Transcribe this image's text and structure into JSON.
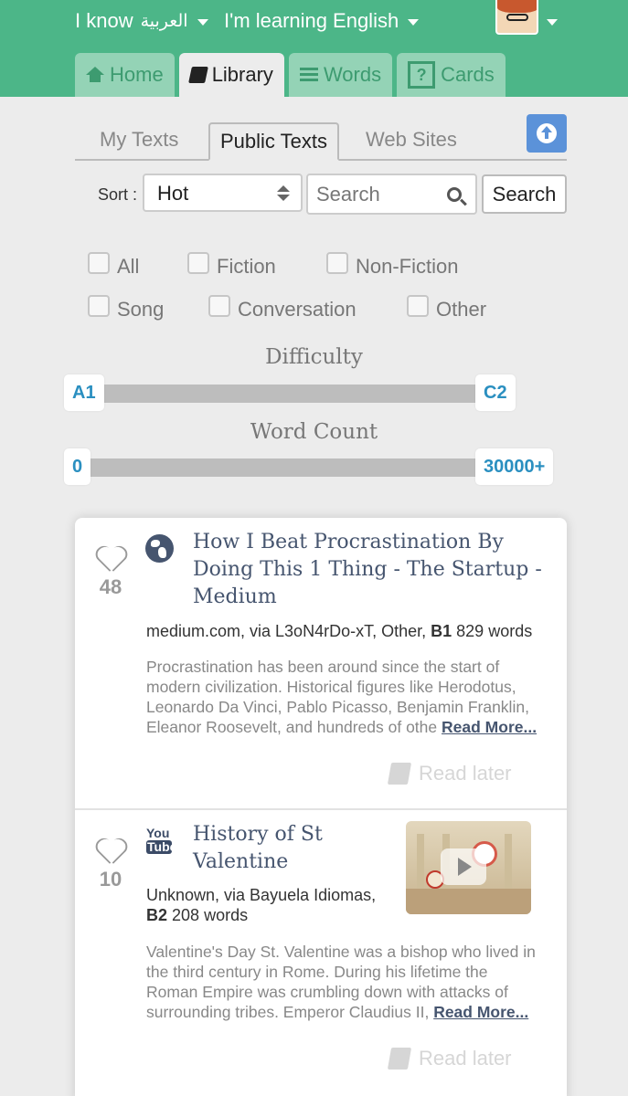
{
  "header": {
    "i_know_label": "I know",
    "i_know_value": "العربية",
    "learning_prefix": "I'm learning",
    "learning_value": "English"
  },
  "nav_tabs": [
    {
      "label": "Home",
      "icon": "home-icon"
    },
    {
      "label": "Library",
      "icon": "book-icon",
      "active": true
    },
    {
      "label": "Words",
      "icon": "list-icon"
    },
    {
      "label": "Cards",
      "icon": "question-card-icon"
    }
  ],
  "sub_tabs": [
    {
      "label": "My Texts"
    },
    {
      "label": "Public Texts",
      "active": true
    },
    {
      "label": "Web Sites"
    }
  ],
  "sort": {
    "label": "Sort :",
    "value": "Hot"
  },
  "search": {
    "placeholder": "Search",
    "button_label": "Search"
  },
  "filters": [
    {
      "label": "All",
      "checked": false
    },
    {
      "label": "Fiction",
      "checked": false
    },
    {
      "label": "Non-Fiction",
      "checked": false
    },
    {
      "label": "Song",
      "checked": false
    },
    {
      "label": "Conversation",
      "checked": false
    },
    {
      "label": "Other",
      "checked": false
    }
  ],
  "difficulty": {
    "title": "Difficulty",
    "min": "A1",
    "max": "C2"
  },
  "word_count": {
    "title": "Word Count",
    "min": "0",
    "max": "30000+"
  },
  "cards": [
    {
      "likes": "48",
      "icon": "globe-icon",
      "title_lines": [
        "How I Beat Procrastination By",
        "Doing This 1 Thing - The Startup -",
        "Medium"
      ],
      "meta_prefix": "medium.com, via L3oN4rDo-xT, Other,",
      "level": "B1",
      "word_count": "829 words",
      "description": "Procrastination has been around since the start of modern civilization. Historical figures like Herodotus, Leonardo Da Vinci, Pablo Picasso, Benjamin Franklin, Eleanor Roosevelt, and hundreds of othe",
      "read_more": "Read More...",
      "read_later": "Read later"
    },
    {
      "likes": "10",
      "icon": "youtube-icon",
      "icon_text_top": "You",
      "icon_text_bottom": "Tube",
      "title_lines": [
        "History of St",
        "Valentine"
      ],
      "meta_prefix": "Unknown, via Bayuela Idiomas,",
      "level": "B2",
      "word_count": "208 words",
      "description": "Valentine's Day St. Valentine was a bishop who lived in the third century in Rome. During his lifetime the Roman Empire was crumbling down with attacks of surrounding tribes. Emperor Claudius II,",
      "read_more": "Read More...",
      "read_later": "Read later"
    }
  ],
  "colors": {
    "header_green": "#4cb688",
    "tab_inactive": "#94d3b6",
    "tab_text": "#3d9b70",
    "upload_blue": "#5b92d9",
    "slider_label": "#2a8fc0",
    "title_navy": "#46556f"
  }
}
